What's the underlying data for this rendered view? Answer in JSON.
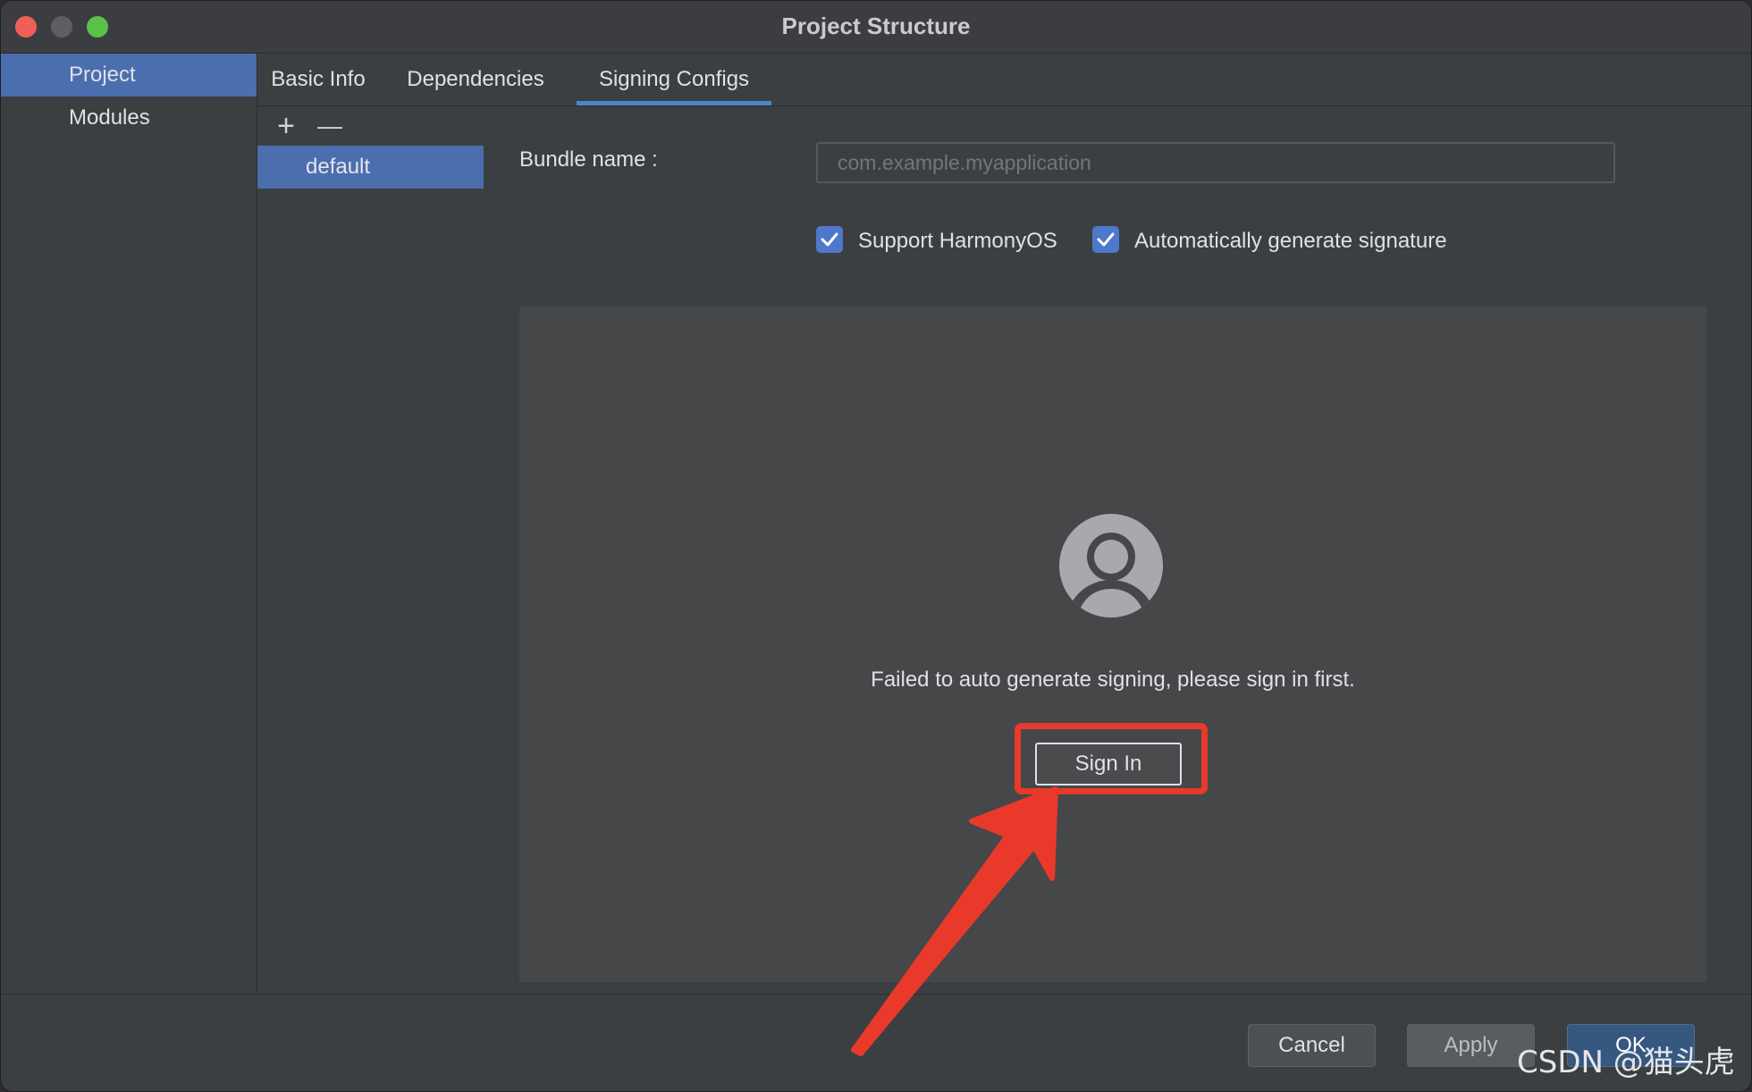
{
  "window": {
    "title": "Project Structure"
  },
  "leftnav": {
    "items": [
      {
        "label": "Project"
      },
      {
        "label": "Modules"
      }
    ]
  },
  "tabs": [
    {
      "label": "Basic Info"
    },
    {
      "label": "Dependencies"
    },
    {
      "label": "Signing Configs"
    }
  ],
  "active_tab": "Signing Configs",
  "configs": {
    "tools": [
      "+",
      "—"
    ],
    "items": [
      {
        "label": "default"
      }
    ]
  },
  "form": {
    "bundle_label": "Bundle name :",
    "bundle_placeholder": "com.example.myapplication",
    "support_harmony": {
      "label": "Support HarmonyOS",
      "checked": true
    },
    "auto_sign": {
      "label": "Automatically generate signature",
      "checked": true
    }
  },
  "signin": {
    "message": "Failed to auto generate signing, please sign in first.",
    "button": "Sign In"
  },
  "footer": {
    "cancel": "Cancel",
    "apply": "Apply",
    "ok": "OK"
  },
  "watermark": "CSDN @猫头虎",
  "colors": {
    "accent": "#4b6eaf",
    "highlight": "#e8392b",
    "checkbox": "#4d78cc"
  }
}
